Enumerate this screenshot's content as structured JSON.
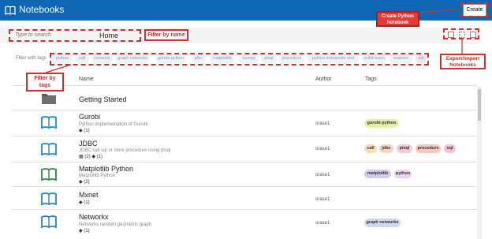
{
  "app": {
    "title": "Notebooks",
    "create_label": "Create"
  },
  "annotations": {
    "create_python": "Create Python\nNotebook",
    "filter_by_name": "Filter by name",
    "export_import": "Export/Import\nNotebooks",
    "filter_by_tags": "Filter by tags"
  },
  "search": {
    "placeholder": "Type to search",
    "current_folder": "Home"
  },
  "tag_filter": {
    "label": "Filter with tags",
    "tags": [
      "python",
      "call",
      "cxoracle",
      "graph networks",
      "gurobi python",
      "jdbc",
      "matplotlib",
      "numpy",
      "plsql",
      "procedure",
      "python interpreter test",
      "scikit-learn",
      "seaborn",
      "sql"
    ]
  },
  "table": {
    "headers": {
      "name": "Name",
      "author": "Author",
      "tags": "Tags"
    },
    "rows": [
      {
        "name": "Getting Started",
        "type": "folder"
      },
      {
        "name": "Gurobi",
        "desc": "Python implementation of Gurobi",
        "meta": "◆ (1)",
        "author": "orase1",
        "tags": [
          "gurobi python"
        ]
      },
      {
        "name": "JDBC",
        "desc": "JDBC call sql or store procedure using plsql",
        "meta": "▦ (2)  ◆ (1)",
        "author": "orase1",
        "tags": [
          "call",
          "jdbc",
          "plsql",
          "procedure",
          "sql"
        ]
      },
      {
        "name": "Matplotlib Python",
        "desc": "Matplotlib Python",
        "meta": "◆ (2)",
        "author": "orase1",
        "tags": [
          "matplotlib",
          "python"
        ]
      },
      {
        "name": "Mxnet",
        "desc": "",
        "meta": "◆ (1)",
        "author": "orase1",
        "tags": []
      },
      {
        "name": "Networkx",
        "desc": "Networks random geometric graph",
        "meta": "◆ (1)",
        "author": "orase1",
        "tags": [
          "graph networkx"
        ]
      }
    ]
  },
  "colors": {
    "titlebar": "#0d67b4",
    "annotation": "#d32f2f",
    "notebook_icon": "#1e88c8",
    "notebook_icon_green": "#2e8b3d",
    "tag_gurobi": "#e6f0a8",
    "tag_call": "#f5ddb6",
    "tag_jdbc": "#f3d6c6",
    "tag_plsql": "#f5c9d2",
    "tag_procedure": "#f7c9bc",
    "tag_sql": "#f5c3d6",
    "tag_matplotlib": "#d4c9ee",
    "tag_python": "#e9d3f0",
    "tag_graph": "#cfd9f3"
  }
}
